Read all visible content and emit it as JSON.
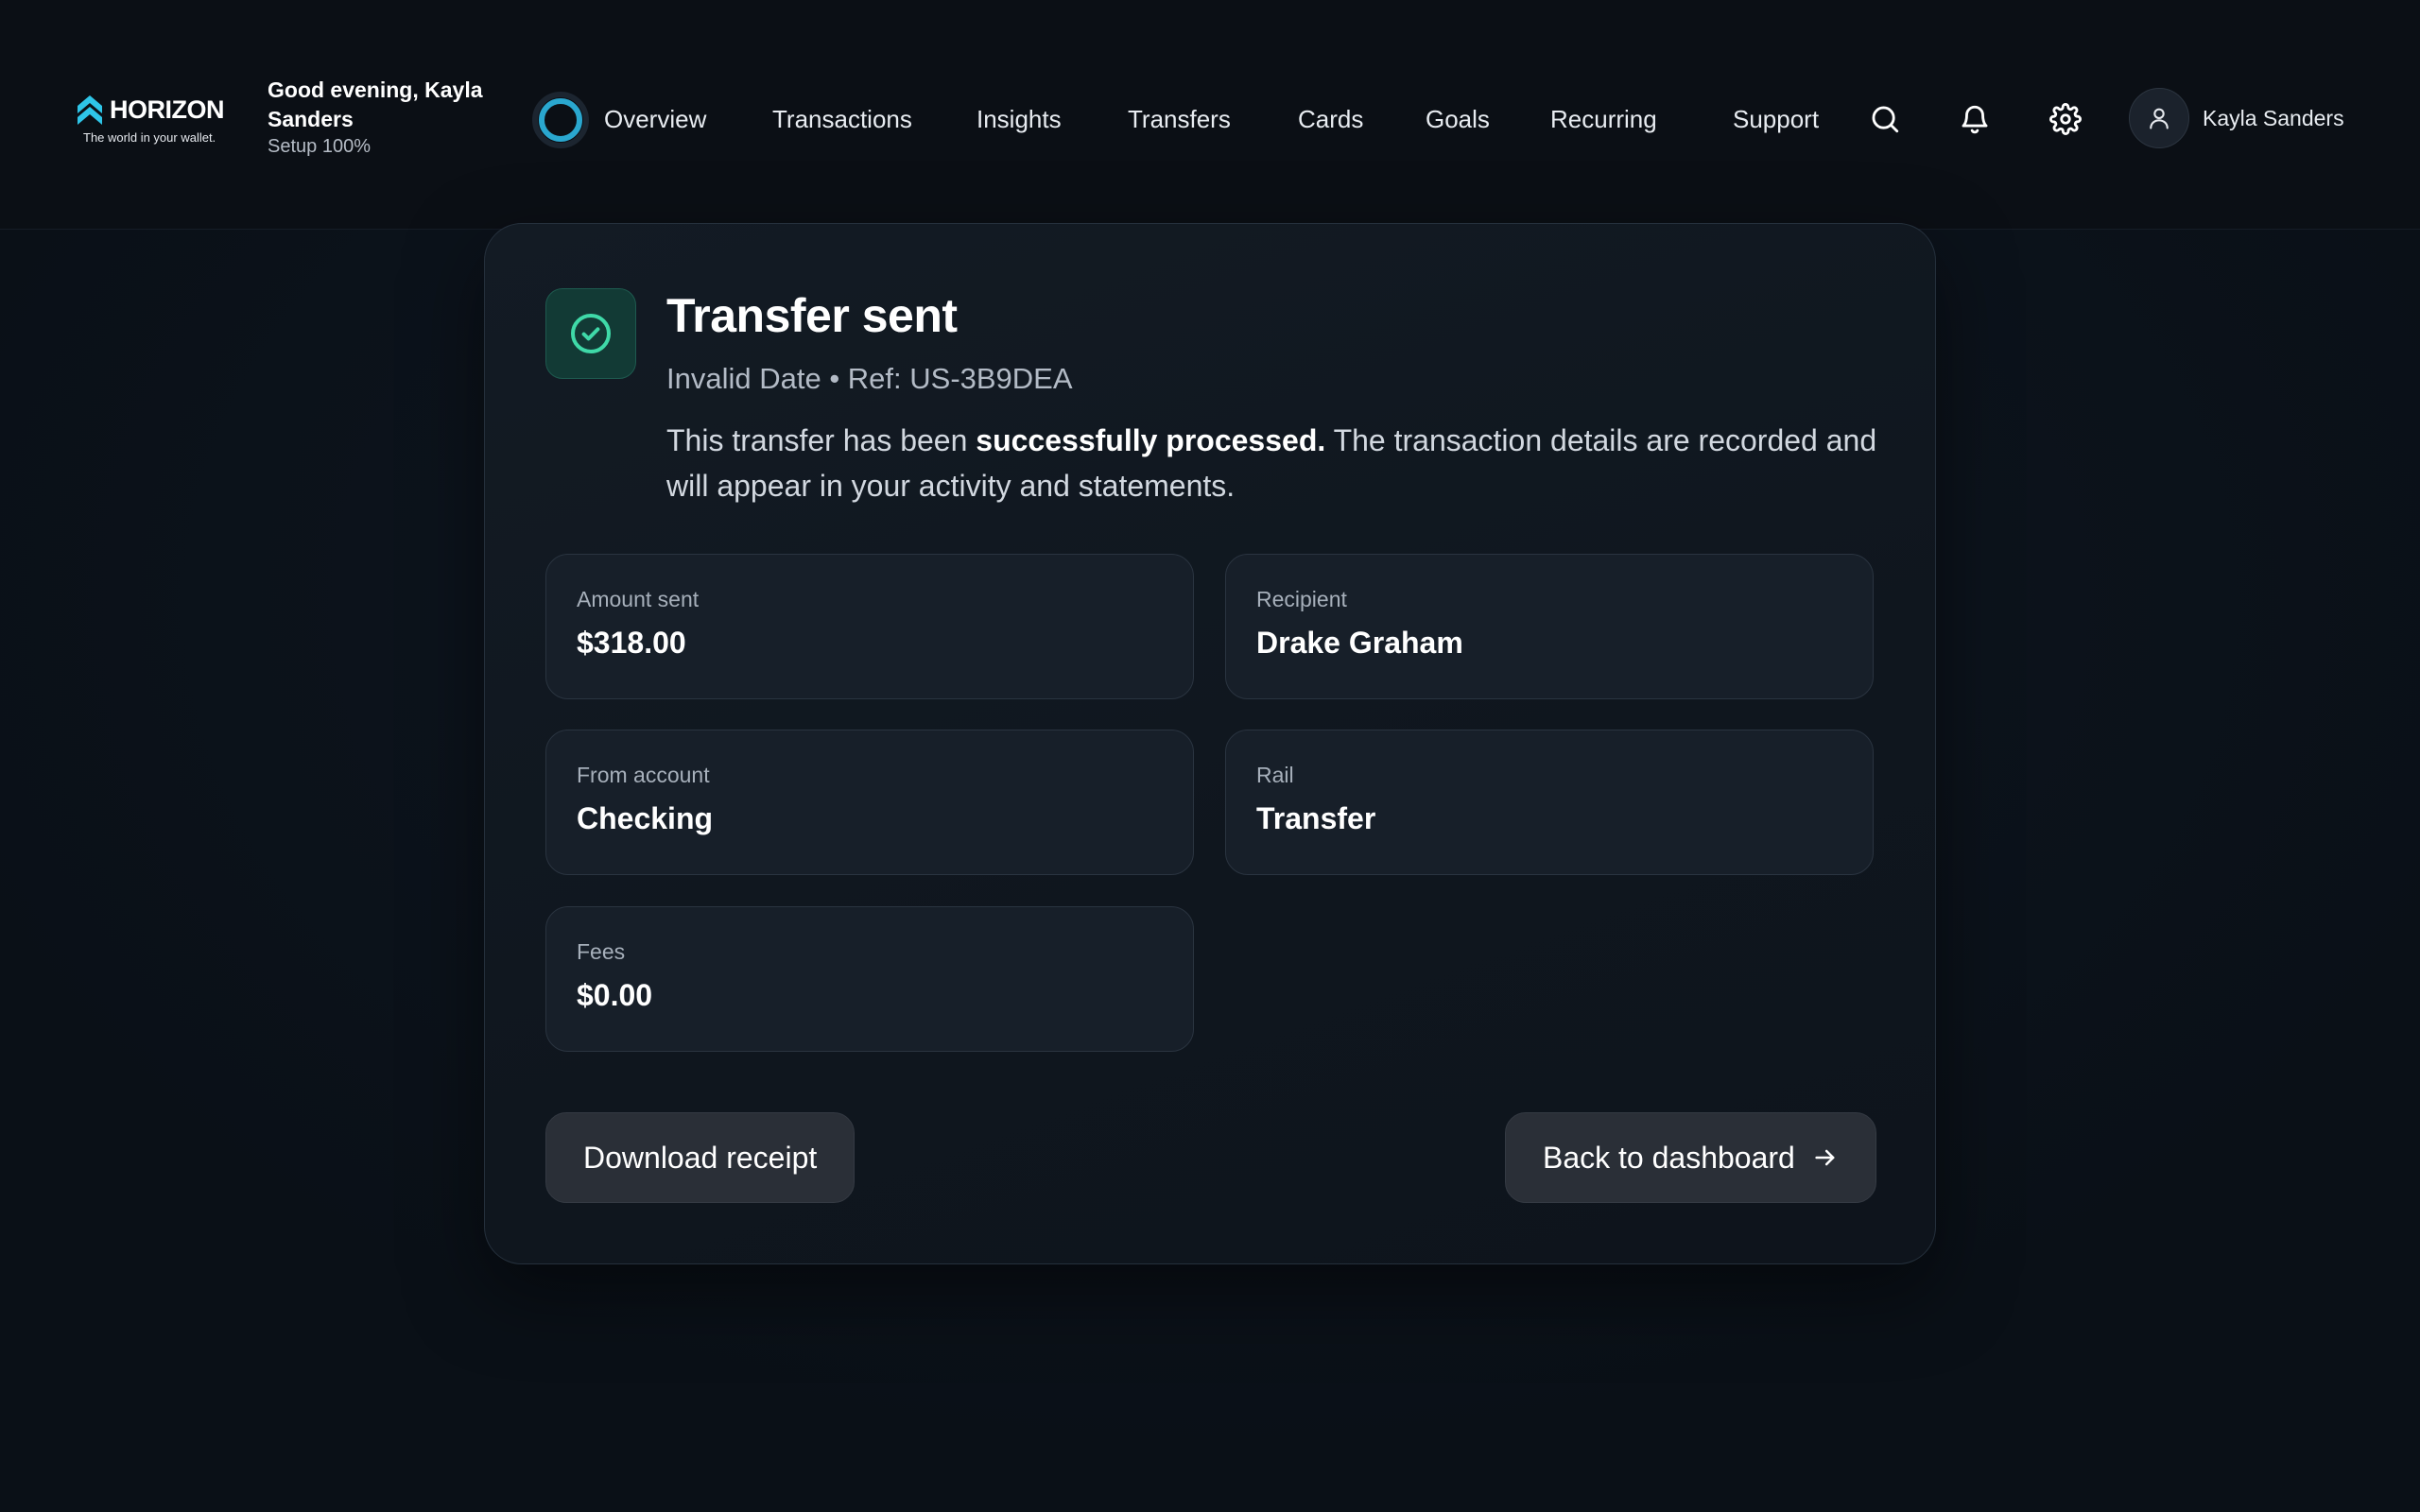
{
  "brand": {
    "name": "HORIZON",
    "tagline": "The world in your wallet.",
    "accent": "#2ec5e8"
  },
  "greeting": {
    "title": "Good evening, Kayla Sanders",
    "setup": "Setup 100%",
    "progress_percent": 100
  },
  "nav": {
    "items": [
      {
        "id": "overview",
        "label": "Overview"
      },
      {
        "id": "transactions",
        "label": "Transactions"
      },
      {
        "id": "insights",
        "label": "Insights"
      },
      {
        "id": "transfers",
        "label": "Transfers"
      },
      {
        "id": "cards",
        "label": "Cards"
      },
      {
        "id": "goals",
        "label": "Goals"
      },
      {
        "id": "recurring",
        "label": "Recurring"
      },
      {
        "id": "support",
        "label": "Support"
      }
    ]
  },
  "header_icons": [
    "search-icon",
    "bell-icon",
    "gear-icon"
  ],
  "user": {
    "name": "Kayla Sanders",
    "avatar_icon": "user-icon"
  },
  "receipt": {
    "title": "Transfer sent",
    "meta": "Invalid Date • Ref: US-3B9DEA",
    "desc_before": "This transfer has been ",
    "desc_bold": "successfully processed.",
    "desc_after": " The transaction details are recorded and will appear in your activity and statements.",
    "status_icon": "check-circle-icon",
    "status_color": "#3fd9a8",
    "fields": [
      {
        "id": "amount",
        "label": "Amount sent",
        "value": "$318.00"
      },
      {
        "id": "recipient",
        "label": "Recipient",
        "value": "Drake Graham"
      },
      {
        "id": "from",
        "label": "From account",
        "value": "Checking"
      },
      {
        "id": "rail",
        "label": "Rail",
        "value": "Transfer"
      },
      {
        "id": "fees",
        "label": "Fees",
        "value": "$0.00"
      }
    ],
    "actions": {
      "download": "Download receipt",
      "back": "Back to dashboard"
    }
  }
}
